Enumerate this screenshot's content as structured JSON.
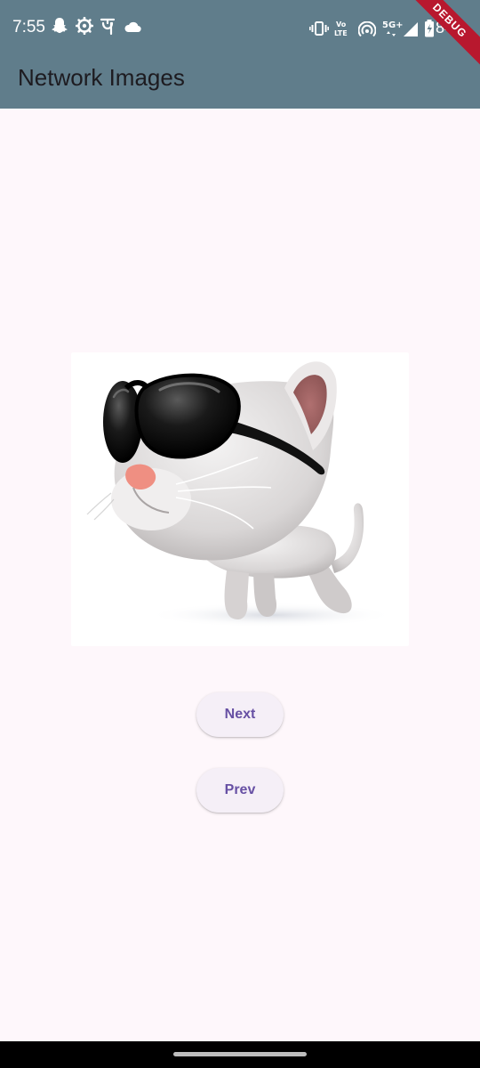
{
  "status_bar": {
    "time": "7:55",
    "battery_percent": "84",
    "left_icons": [
      "snapchat-icon",
      "settings-gear-icon",
      "phonepe-icon",
      "cloud-icon"
    ],
    "right_icons": [
      "vibrate-icon",
      "volte-icon",
      "hotspot-icon",
      "5g-icon",
      "signal-icon",
      "battery-icon"
    ]
  },
  "app_bar": {
    "title": "Network Images",
    "color": "#607d8b"
  },
  "debug_banner": {
    "label": "DEBUG"
  },
  "image": {
    "icon": "cat-with-sunglasses-image"
  },
  "buttons": {
    "next_label": "Next",
    "prev_label": "Prev"
  },
  "colors": {
    "background": "#fef7fb",
    "button_text": "#6750a4",
    "button_bg": "#f5eff7"
  }
}
